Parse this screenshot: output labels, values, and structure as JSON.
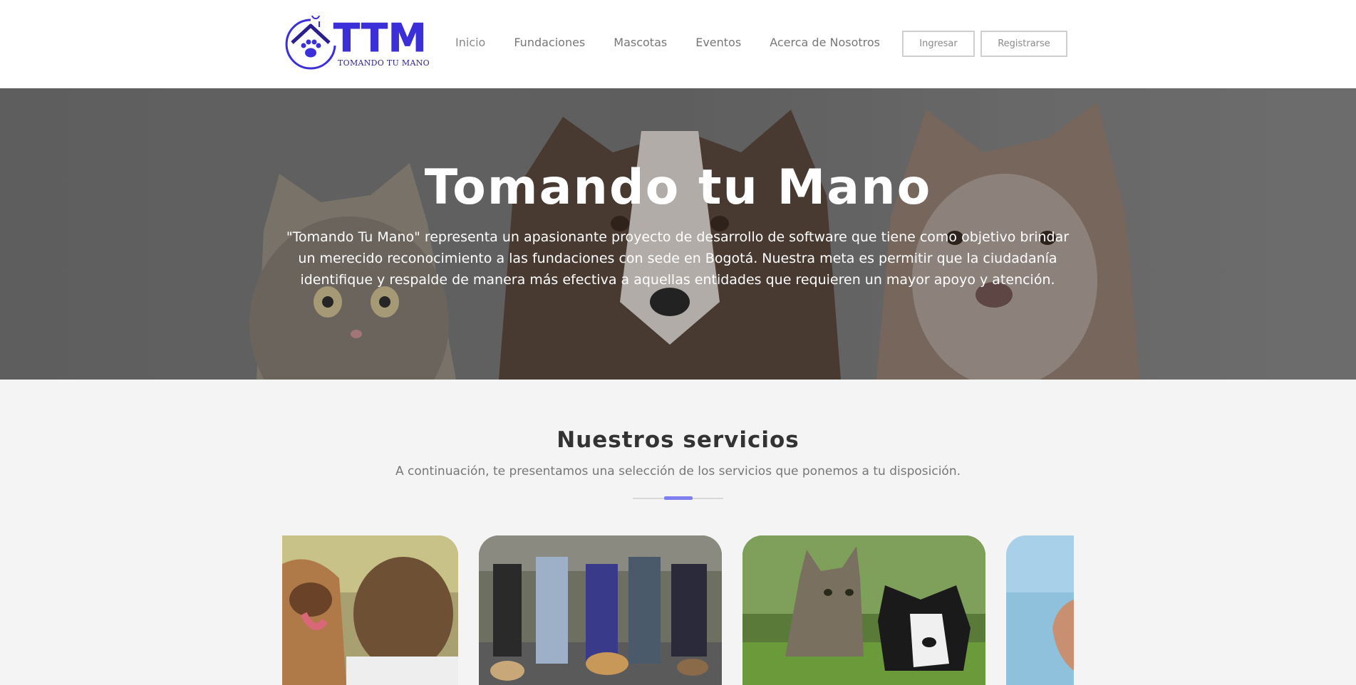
{
  "brand": {
    "logo_text": "TTM",
    "logo_subtitle": "TOMANDO TU MANO",
    "accent_color": "#3a2fd8"
  },
  "nav": {
    "items": [
      {
        "label": "Inicio"
      },
      {
        "label": "Fundaciones"
      },
      {
        "label": "Mascotas"
      },
      {
        "label": "Eventos"
      },
      {
        "label": "Acerca de Nosotros"
      }
    ],
    "login_label": "Ingresar",
    "register_label": "Registrarse"
  },
  "hero": {
    "title": "Tomando tu Mano",
    "text": "\"Tomando Tu Mano\" representa un apasionante proyecto de desarrollo de software que tiene como objetivo brindar un merecido reconocimiento a las fundaciones con sede en Bogotá. Nuestra meta es permitir que la ciudadanía identifique y respalde de manera más efectiva a aquellas entidades que requieren un mayor apoyo y atención."
  },
  "services": {
    "title": "Nuestros servicios",
    "subtitle": "A continuación, te presentamos una selección de los servicios que ponemos a tu disposición.",
    "divider_accent_color": "#7f7ff0",
    "cards": [
      {
        "image": "man-hugging-dog-photo"
      },
      {
        "image": "people-walking-dogs-photo"
      },
      {
        "image": "cat-and-puppy-on-grass-photo"
      },
      {
        "image": "hand-sky-photo"
      }
    ]
  }
}
